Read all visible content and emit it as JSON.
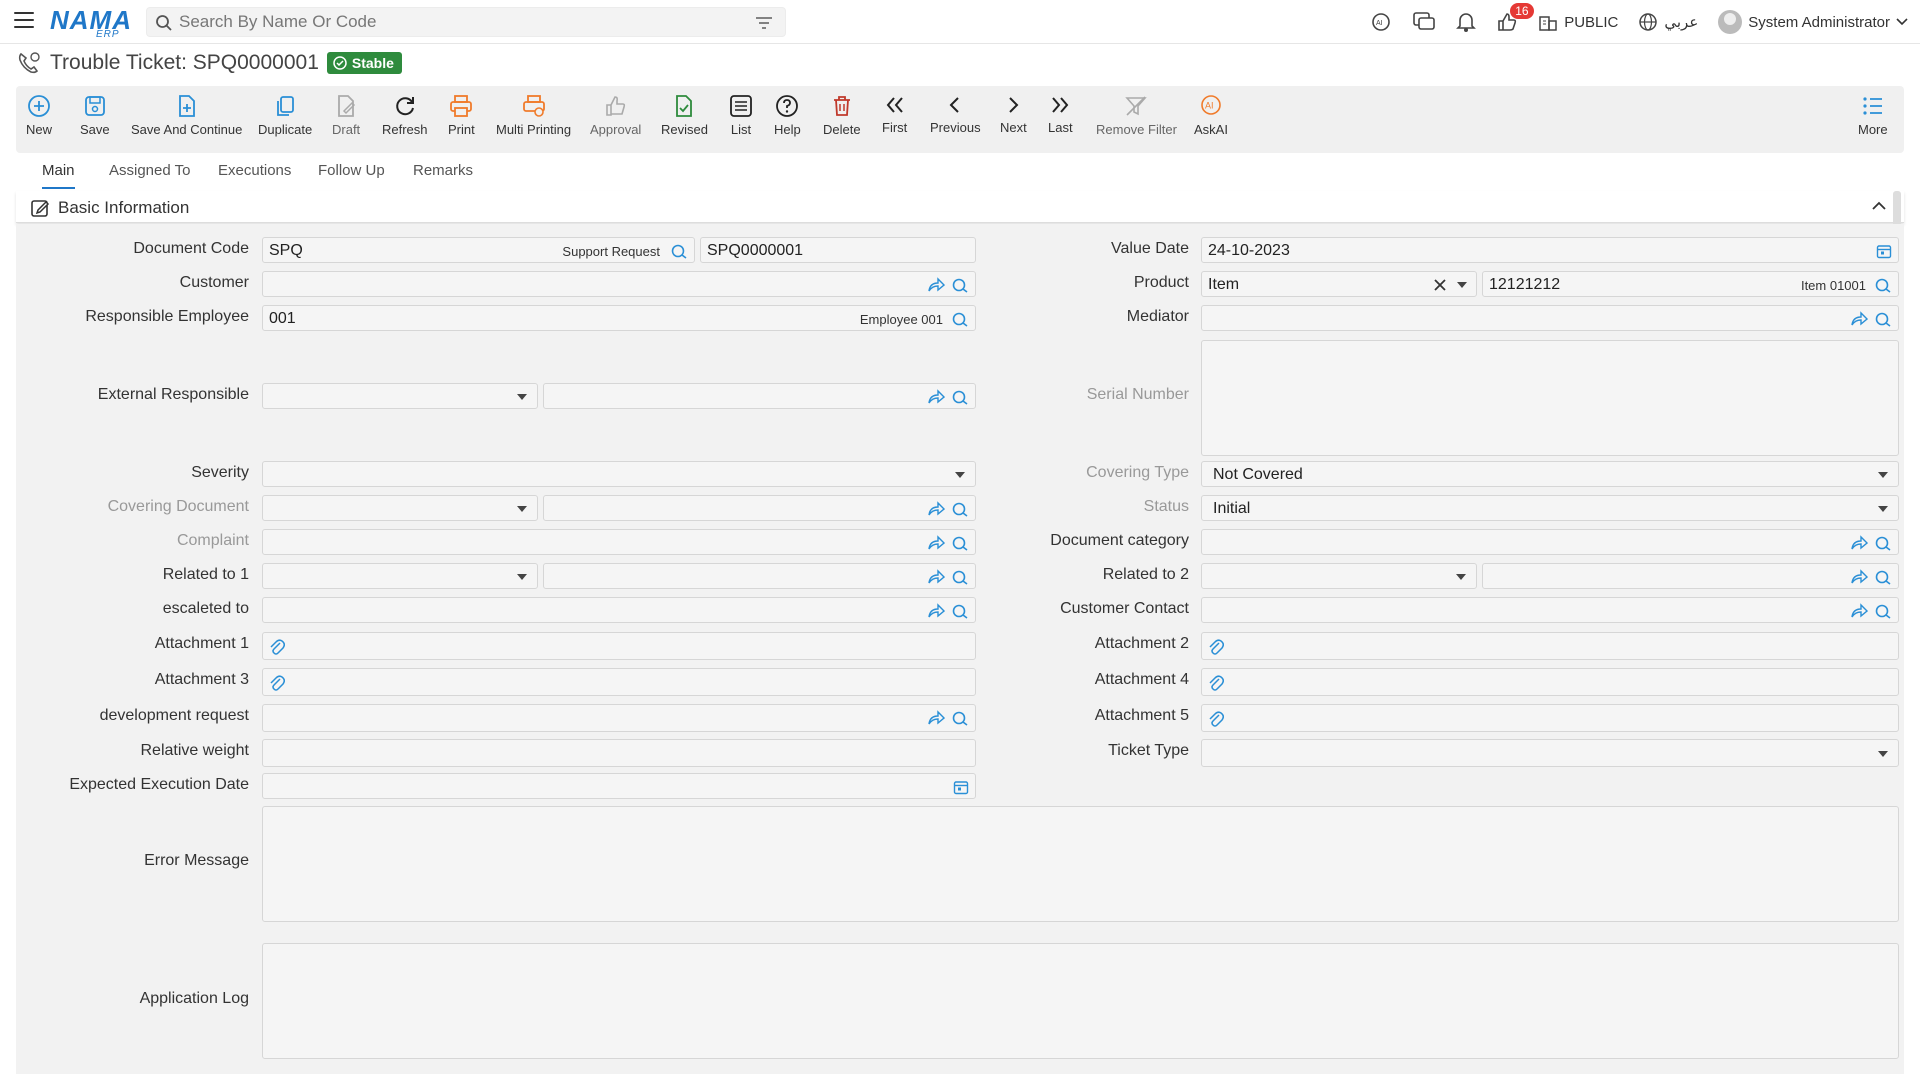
{
  "topbar": {
    "logo": "NAMA",
    "logo_sub": "ERP",
    "search_placeholder": "Search By Name Or Code",
    "notification_count": "16",
    "public_label": "PUBLIC",
    "language_label": "عربي",
    "user_label": "System Administrator"
  },
  "title": {
    "text": "Trouble Ticket: SPQ0000001",
    "status": "Stable",
    "status_color": "#2e8b3d"
  },
  "toolbar": {
    "new": "New",
    "save": "Save",
    "save_continue": "Save And Continue",
    "duplicate": "Duplicate",
    "draft": "Draft",
    "refresh": "Refresh",
    "print": "Print",
    "multi_printing": "Multi Printing",
    "approval": "Approval",
    "revised": "Revised",
    "list": "List",
    "help": "Help",
    "delete": "Delete",
    "first": "First",
    "previous": "Previous",
    "next": "Next",
    "last": "Last",
    "remove_filter": "Remove Filter",
    "askai": "AskAI",
    "more": "More"
  },
  "tabs": [
    "Main",
    "Assigned To",
    "Executions",
    "Follow Up",
    "Remarks"
  ],
  "section": {
    "title": "Basic Information"
  },
  "form": {
    "document_code": {
      "label": "Document Code",
      "code": "SPQ",
      "desc": "Support Request",
      "number": "SPQ0000001"
    },
    "customer": {
      "label": "Customer"
    },
    "responsible_employee": {
      "label": "Responsible Employee",
      "code": "001",
      "desc": "Employee 001"
    },
    "external_responsible": {
      "label": "External Responsible"
    },
    "severity": {
      "label": "Severity"
    },
    "covering_document": {
      "label": "Covering Document"
    },
    "complaint": {
      "label": "Complaint"
    },
    "related_to_1": {
      "label": "Related to 1"
    },
    "escalated_to": {
      "label": "escaleted to"
    },
    "attachment_1": {
      "label": "Attachment 1"
    },
    "attachment_3": {
      "label": "Attachment 3"
    },
    "development_request": {
      "label": "development request"
    },
    "relative_weight": {
      "label": "Relative weight"
    },
    "expected_execution_date": {
      "label": "Expected Execution Date"
    },
    "error_message": {
      "label": "Error Message"
    },
    "application_log": {
      "label": "Application Log"
    },
    "value_date": {
      "label": "Value Date",
      "value": "24-10-2023"
    },
    "product": {
      "label": "Product",
      "type": "Item",
      "code": "12121212",
      "desc": "Item 01001"
    },
    "mediator": {
      "label": "Mediator"
    },
    "serial_number": {
      "label": "Serial Number"
    },
    "covering_type": {
      "label": "Covering Type",
      "value": "Not Covered"
    },
    "status": {
      "label": "Status",
      "value": "Initial"
    },
    "document_category": {
      "label": "Document category"
    },
    "related_to_2": {
      "label": "Related to 2"
    },
    "customer_contact": {
      "label": "Customer Contact"
    },
    "attachment_2": {
      "label": "Attachment 2"
    },
    "attachment_4": {
      "label": "Attachment 4"
    },
    "attachment_5": {
      "label": "Attachment 5"
    },
    "ticket_type": {
      "label": "Ticket Type"
    }
  },
  "colors": {
    "accent": "#1f77c8",
    "icon_blue": "#2a8fd6",
    "print_orange": "#f07b2b",
    "delete_red": "#c0392b",
    "revised_green": "#2e8b3d"
  }
}
